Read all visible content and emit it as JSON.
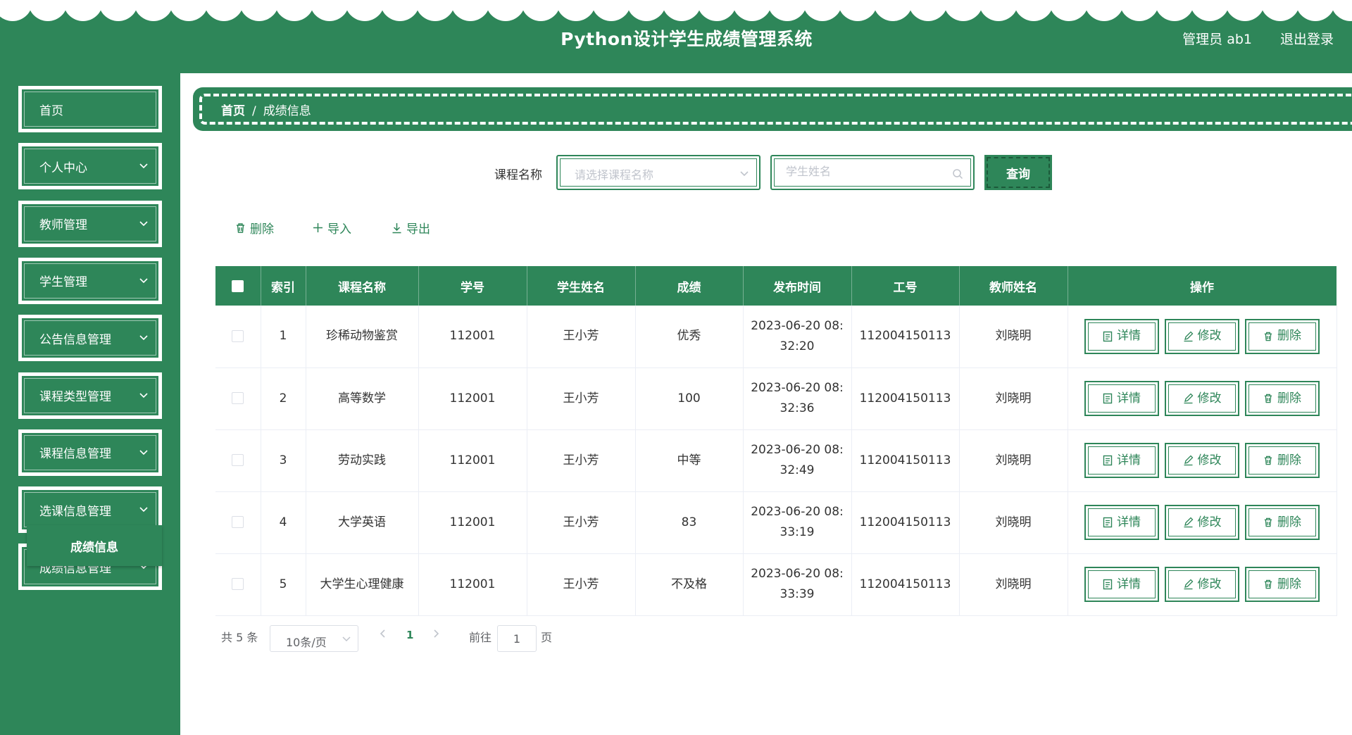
{
  "colors": {
    "primary": "#2e8659",
    "white": "#ffffff",
    "text": "#333333",
    "placeholder": "#c0c4cc"
  },
  "header": {
    "title": "Python设计学生成绩管理系统",
    "user": "管理员 ab1",
    "logout": "退出登录"
  },
  "sidebar": {
    "items": [
      {
        "label": "首页",
        "has_arrow": false
      },
      {
        "label": "个人中心",
        "has_arrow": true
      },
      {
        "label": "教师管理",
        "has_arrow": true
      },
      {
        "label": "学生管理",
        "has_arrow": true
      },
      {
        "label": "公告信息管理",
        "has_arrow": true
      },
      {
        "label": "课程类型管理",
        "has_arrow": true
      },
      {
        "label": "课程信息管理",
        "has_arrow": true
      },
      {
        "label": "选课信息管理",
        "has_arrow": true
      },
      {
        "label": "成绩信息管理",
        "has_arrow": true
      }
    ],
    "submenu_active": "成绩信息"
  },
  "breadcrumb": {
    "home": "首页",
    "separator": "/",
    "current": "成绩信息"
  },
  "search": {
    "course_label": "课程名称",
    "course_placeholder": "请选择课程名称",
    "name_placeholder": "学生姓名",
    "query_button": "查询"
  },
  "toolbar": {
    "delete": "删除",
    "import": "导入",
    "export": "导出"
  },
  "table": {
    "headers": [
      "索引",
      "课程名称",
      "学号",
      "学生姓名",
      "成绩",
      "发布时间",
      "工号",
      "教师姓名",
      "操作"
    ],
    "actions": {
      "detail": "详情",
      "edit": "修改",
      "delete": "删除"
    },
    "rows": [
      {
        "index": "1",
        "course": "珍稀动物鉴赏",
        "student_no": "112001",
        "student_name": "王小芳",
        "score": "优秀",
        "time_line1": "2023-06-20 08:",
        "time_line2": "32:20",
        "teacher_no": "112004150113",
        "teacher_name": "刘晓明"
      },
      {
        "index": "2",
        "course": "高等数学",
        "student_no": "112001",
        "student_name": "王小芳",
        "score": "100",
        "time_line1": "2023-06-20 08:",
        "time_line2": "32:36",
        "teacher_no": "112004150113",
        "teacher_name": "刘晓明"
      },
      {
        "index": "3",
        "course": "劳动实践",
        "student_no": "112001",
        "student_name": "王小芳",
        "score": "中等",
        "time_line1": "2023-06-20 08:",
        "time_line2": "32:49",
        "teacher_no": "112004150113",
        "teacher_name": "刘晓明"
      },
      {
        "index": "4",
        "course": "大学英语",
        "student_no": "112001",
        "student_name": "王小芳",
        "score": "83",
        "time_line1": "2023-06-20 08:",
        "time_line2": "33:19",
        "teacher_no": "112004150113",
        "teacher_name": "刘晓明"
      },
      {
        "index": "5",
        "course": "大学生心理健康",
        "student_no": "112001",
        "student_name": "王小芳",
        "score": "不及格",
        "time_line1": "2023-06-20 08:",
        "time_line2": "33:39",
        "teacher_no": "112004150113",
        "teacher_name": "刘晓明"
      }
    ]
  },
  "pagination": {
    "total": "共 5 条",
    "page_size": "10条/页",
    "current_page": "1",
    "goto_label": "前往",
    "goto_value": "1",
    "page_unit": "页"
  }
}
